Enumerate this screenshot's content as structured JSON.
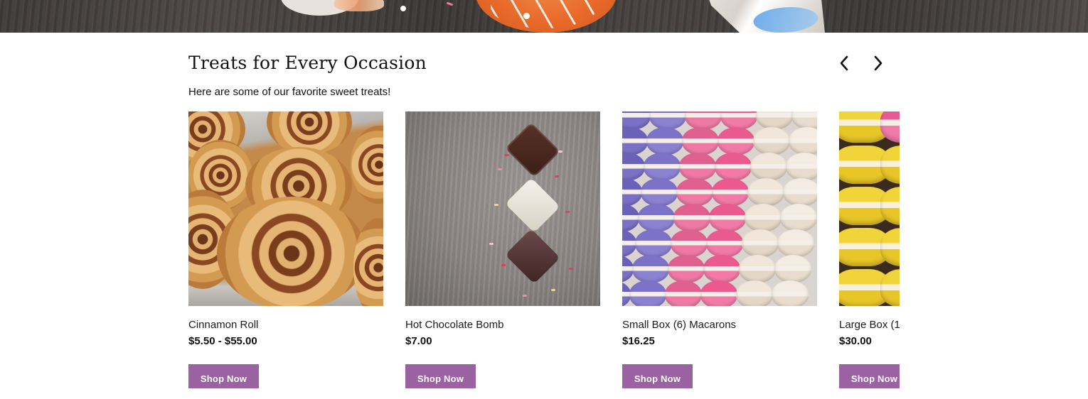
{
  "hero": {
    "carousel_indicator": "active-dot"
  },
  "section": {
    "title": "Treats for Every Occasion",
    "subtitle": "Here are some of our favorite sweet treats!"
  },
  "nav": {
    "prev_icon": "chevron-left-icon",
    "next_icon": "chevron-right-icon"
  },
  "products": [
    {
      "name": "Cinnamon Roll",
      "price": "$5.50 - $55.00",
      "button": "Shop Now",
      "image": "cinnamon-rolls-photo"
    },
    {
      "name": "Hot Chocolate Bomb",
      "price": "$7.00",
      "button": "Shop Now",
      "image": "hot-chocolate-bombs-photo"
    },
    {
      "name": "Small Box (6) Macarons",
      "price": "$16.25",
      "button": "Shop Now",
      "image": "macarons-photo"
    },
    {
      "name": "Large Box (1",
      "price": "$30.00",
      "button": "Shop Now",
      "image": "yellow-macarons-photo"
    }
  ],
  "colors": {
    "button_bg": "#9a62a0",
    "button_text": "#ffffff",
    "text": "#111111"
  }
}
